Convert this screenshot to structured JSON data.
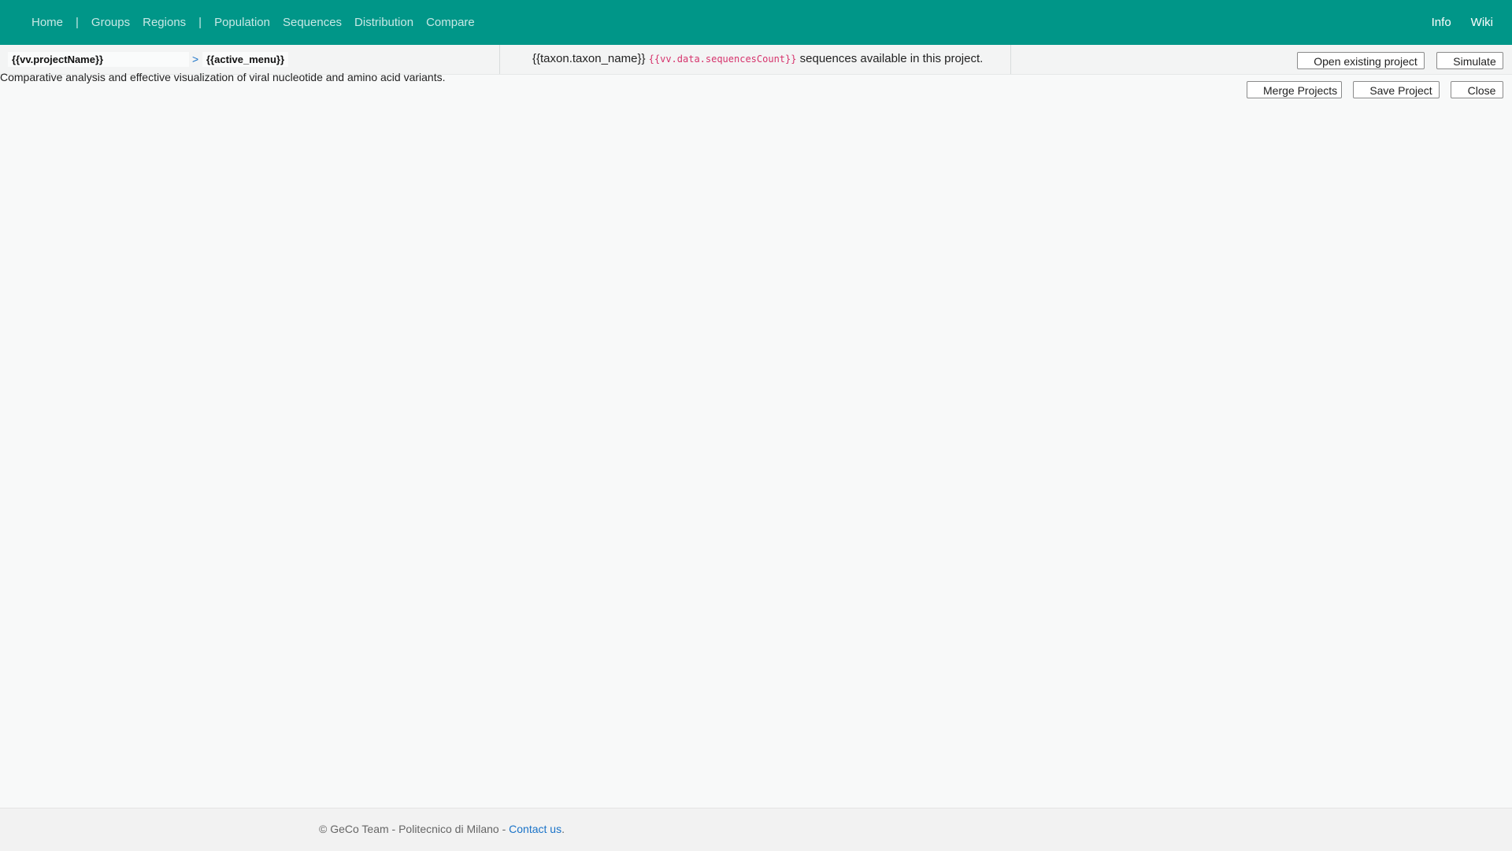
{
  "nav": {
    "items": [
      "Home",
      "|",
      "Groups",
      "Regions",
      "|",
      "Population",
      "Sequences",
      "Distribution",
      "Compare"
    ],
    "right_items": [
      "Info",
      "Wiki"
    ]
  },
  "toolbar": {
    "project_name": "{{vv.projectName}}",
    "separator": ">",
    "active_menu": "{{active_menu}}",
    "taxon_name": "{{taxon.taxon_name}}",
    "sequences_count": "{{vv.data.sequencesCount}}",
    "sequences_suffix": "sequences available in this project.",
    "open_project_label": "Open existing project",
    "simulate_label": "Simulate"
  },
  "actions": {
    "merge_label": "Merge Projects",
    "save_label": "Save Project",
    "close_label": "Close"
  },
  "description": "Comparative analysis and effective visualization of viral nucleotide and amino acid variants.",
  "footer": {
    "text": "© GeCo Team - Politecnico di Milano - ",
    "contact_label": "Contact us",
    "period": "."
  },
  "colors": {
    "header_bg": "#009688",
    "link": "#1a73c8",
    "code": "#d6336c"
  }
}
